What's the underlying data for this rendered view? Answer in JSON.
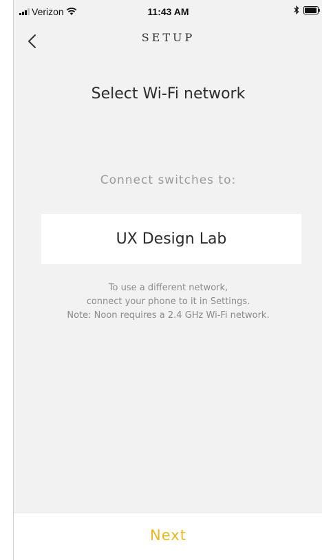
{
  "status_bar": {
    "carrier": "Verizon",
    "time": "11:43 AM",
    "icons": [
      "signal-icon",
      "wifi-icon",
      "bluetooth-icon",
      "battery-icon"
    ]
  },
  "nav": {
    "title": "SETUP",
    "back_icon": "chevron-left-icon"
  },
  "main": {
    "title": "Select Wi-Fi network",
    "connect_label": "Connect switches to:",
    "network_name": "UX Design Lab",
    "help_lines": [
      "To use a different network,",
      "connect your phone to it in Settings.",
      "Note: Noon requires a 2.4 GHz Wi-Fi network."
    ]
  },
  "footer": {
    "next_label": "Next"
  },
  "colors": {
    "background": "#f2f2f2",
    "accent": "#e8b923",
    "text_primary": "#2b2b2b",
    "text_secondary": "#8a8a8a"
  }
}
